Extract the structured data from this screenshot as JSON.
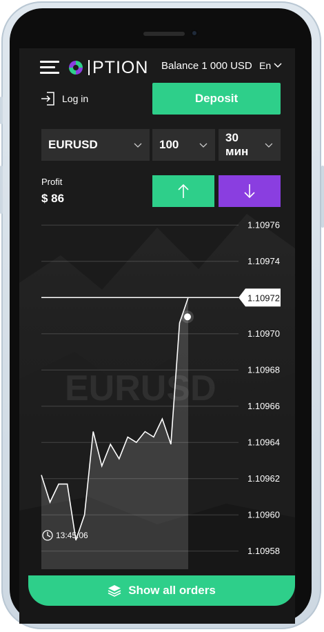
{
  "header": {
    "logo_text": "PTION",
    "balance": "Balance 1 000 USD",
    "language": "En"
  },
  "auth": {
    "login_label": "Log in"
  },
  "deposit_label": "Deposit",
  "controls": {
    "asset": "EURUSD",
    "amount": "100",
    "duration": "30 мин"
  },
  "profit": {
    "label": "Profit",
    "value": "$ 86"
  },
  "chart_data": {
    "type": "line",
    "asset_watermark": "EURUSD",
    "ylim": [
      1.10957,
      1.10977
    ],
    "y_ticks": [
      "1.10976",
      "1.10974",
      "1.10972",
      "1.10970",
      "1.10968",
      "1.10966",
      "1.10964",
      "1.10962",
      "1.10960",
      "1.10958"
    ],
    "y_tick_values": [
      1.10976,
      1.10974,
      1.10972,
      1.1097,
      1.10968,
      1.10966,
      1.10964,
      1.10962,
      1.1096,
      1.10958
    ],
    "current_price": "1.10972",
    "current_price_value": 1.10972,
    "start_time": "13:45:06",
    "series": [
      {
        "values": [
          1.109622,
          1.109607,
          1.109617,
          1.109617,
          1.109586,
          1.1096,
          1.109646,
          1.109627,
          1.109639,
          1.109631,
          1.109643,
          1.10964,
          1.109646,
          1.109643,
          1.109653,
          1.109639,
          1.109706,
          1.10972
        ]
      }
    ]
  },
  "footer": {
    "orders_label": "Show all orders"
  },
  "colors": {
    "green": "#2ecf8a",
    "purple": "#8a3ee0",
    "background": "#1b1b1b"
  },
  "icons": {
    "menu": "hamburger-icon",
    "login": "login-icon",
    "up": "arrow-up-icon",
    "down": "arrow-down-icon",
    "clock": "clock-icon",
    "orders": "layers-icon"
  }
}
